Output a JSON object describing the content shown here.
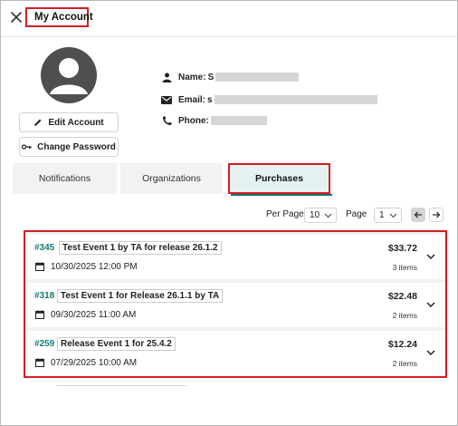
{
  "header": {
    "title": "My Account"
  },
  "profile": {
    "edit_account_label": "Edit Account",
    "change_password_label": "Change Password",
    "name_label": "Name:",
    "name_value_visible": "S",
    "email_label": "Email:",
    "email_value_visible": "s",
    "phone_label": "Phone:"
  },
  "tabs": [
    {
      "label": "Notifications",
      "active": false
    },
    {
      "label": "Organizations",
      "active": false
    },
    {
      "label": "Purchases",
      "active": true
    }
  ],
  "pager": {
    "per_page_label": "Per Page",
    "per_page_value": "10",
    "page_label": "Page",
    "page_value": "1"
  },
  "orders": [
    {
      "number": "#345",
      "name": "Test Event 1 by TA for release 26.1.2",
      "date": "10/30/2025 12:00 PM",
      "price": "$33.72",
      "items": "3 items"
    },
    {
      "number": "#318",
      "name": "Test Event 1 for Release 26.1.1 by TA",
      "date": "09/30/2025 11:00 AM",
      "price": "$22.48",
      "items": "2 items"
    },
    {
      "number": "#259",
      "name": "Release Event 1 for 25.4.2",
      "date": "07/29/2025 10:00 AM",
      "price": "$12.24",
      "items": "2 items"
    }
  ],
  "colors": {
    "accent": "#1a7a73",
    "highlight_border": "#d21e24",
    "active_tab_bg": "#e6f2f1"
  },
  "icons": [
    "close-icon",
    "avatar-user-icon",
    "pencil-icon",
    "key-icon",
    "person-icon",
    "envelope-icon",
    "phone-icon",
    "calendar-icon",
    "chevron-down-icon",
    "arrow-left-icon",
    "arrow-right-icon"
  ]
}
